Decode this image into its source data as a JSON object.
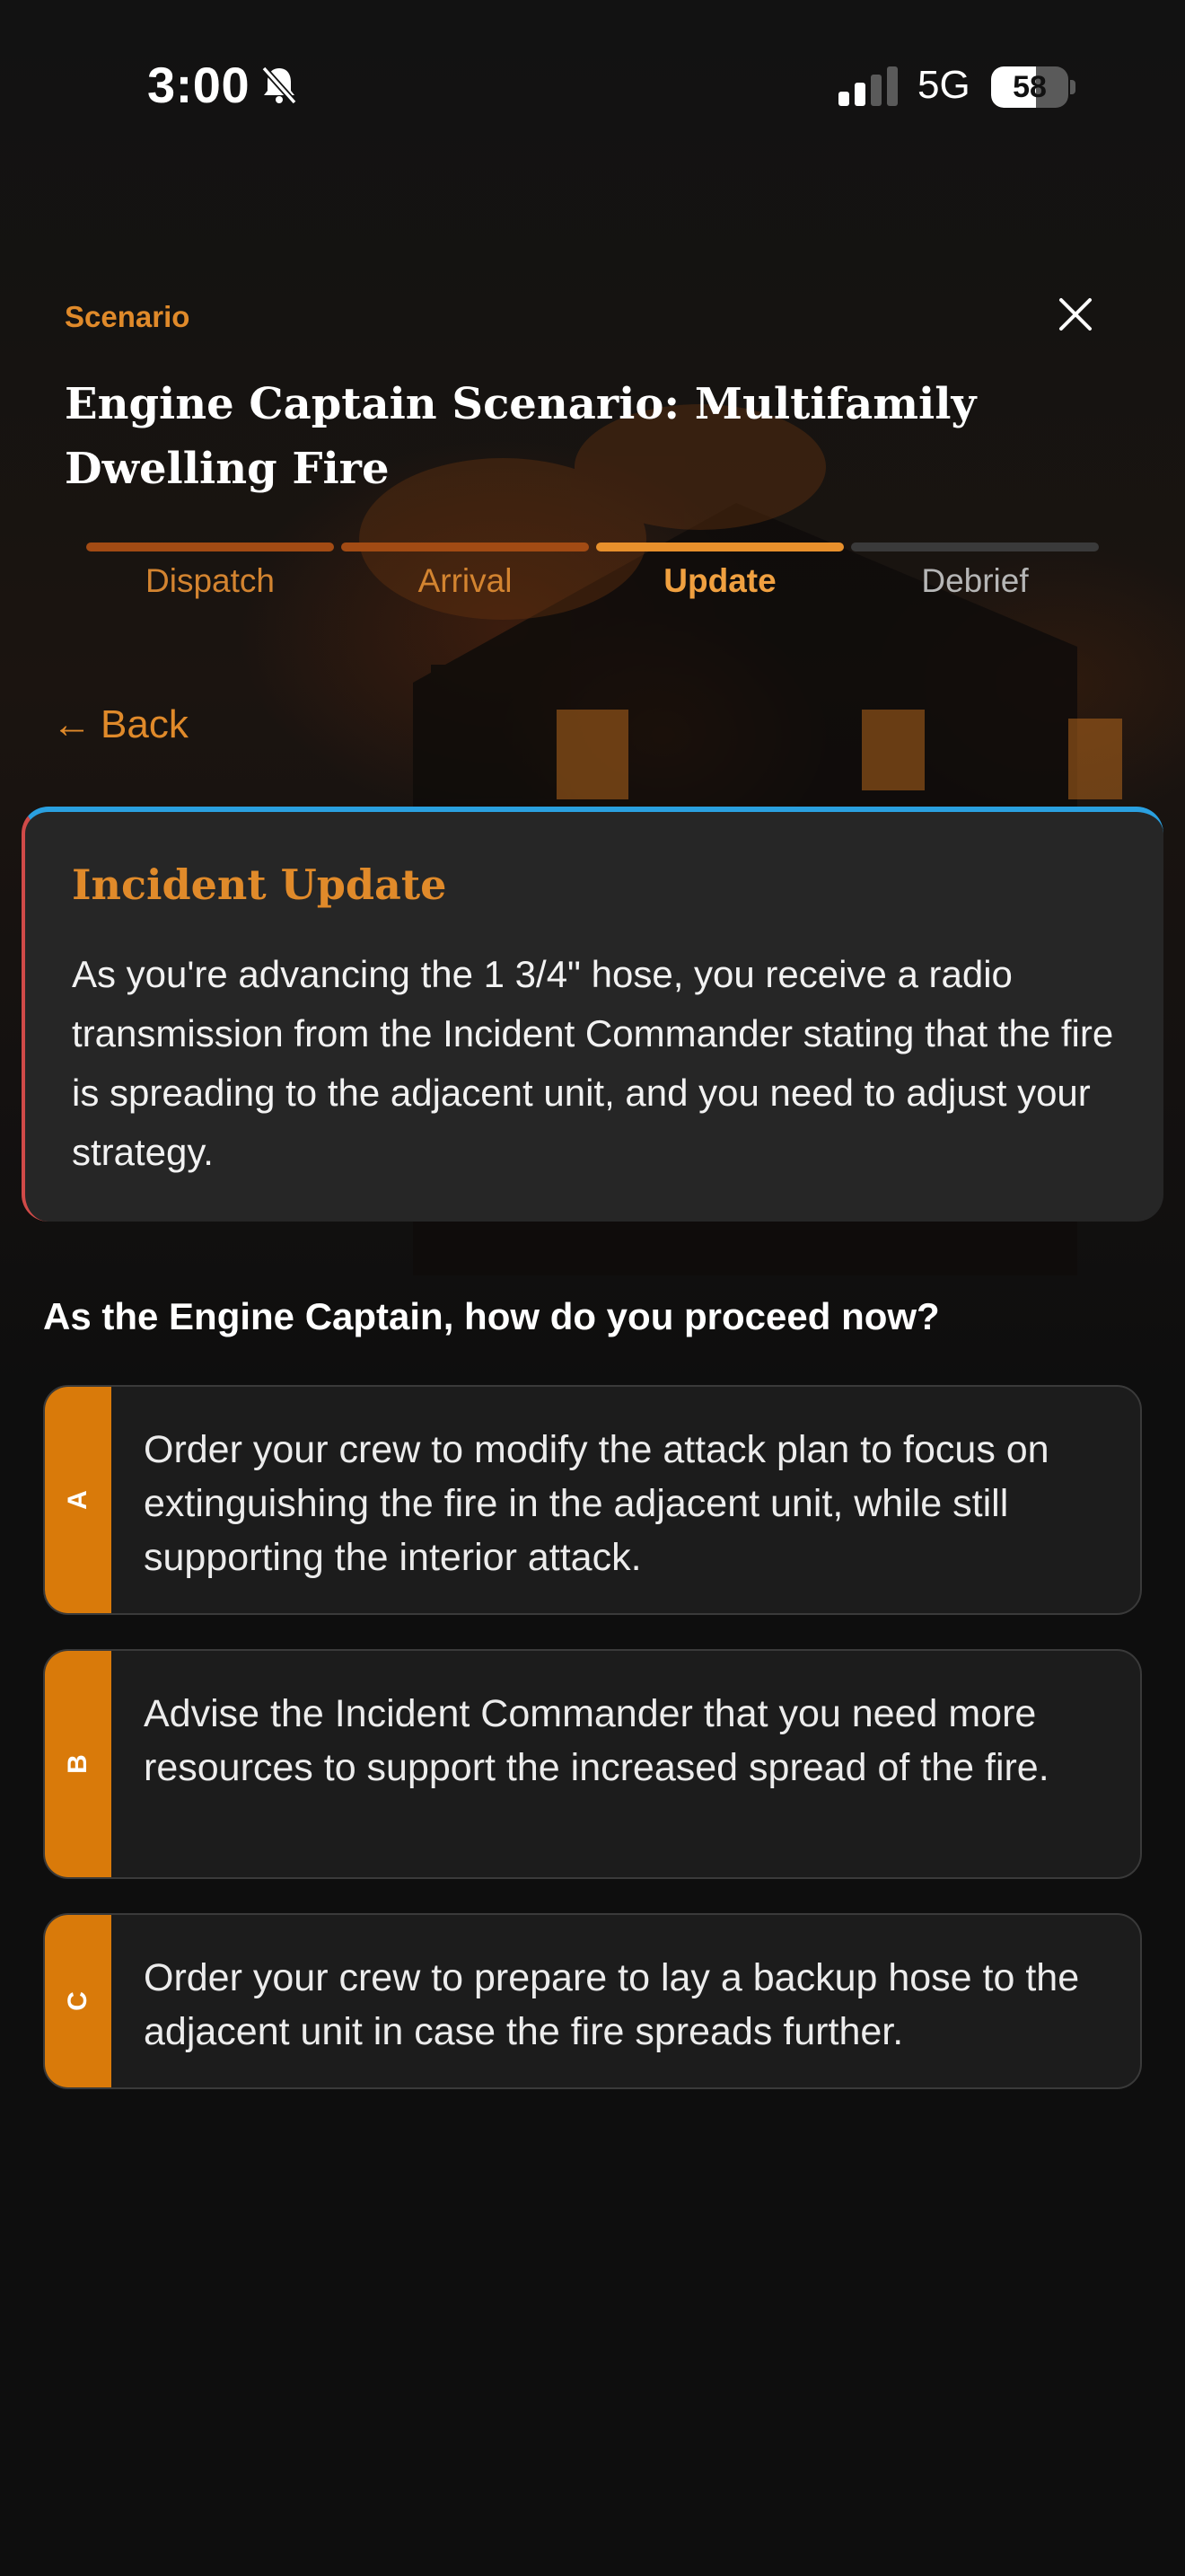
{
  "status_bar": {
    "time": "3:00",
    "network": "5G",
    "battery": "58",
    "battery_level": 0.58
  },
  "header": {
    "eyebrow": "Scenario",
    "title": "Engine Captain Scenario: Multifamily Dwelling Fire"
  },
  "steps": [
    {
      "label": "Dispatch",
      "state": "done"
    },
    {
      "label": "Arrival",
      "state": "done"
    },
    {
      "label": "Update",
      "state": "active"
    },
    {
      "label": "Debrief",
      "state": "future"
    }
  ],
  "back": {
    "arrow": "←",
    "label": "Back"
  },
  "update": {
    "heading": "Incident Update",
    "body": "As you're advancing the 1 3/4\" hose, you receive a radio transmission from the Incident Commander stating that the fire is spreading to the adjacent unit, and you need to adjust your strategy."
  },
  "question": "As the Engine Captain, how do you proceed now?",
  "options": [
    {
      "letter": "A",
      "text": "Order your crew to modify the attack plan to focus on extinguishing the fire in the adjacent unit, while still supporting the interior attack."
    },
    {
      "letter": "B",
      "text": "Advise the Incident Commander that you need more resources to support the increased spread of the fire."
    },
    {
      "letter": "C",
      "text": "Order your crew to prepare to lay a backup hose to the adjacent unit in case the fire spreads further."
    }
  ],
  "colors": {
    "accent": "#e08a2a",
    "option_tag": "#d97a0a",
    "card_top": "#2aa0e0",
    "card_left": "#d04a48"
  },
  "icons": {
    "mute": "bell-slash-icon",
    "close": "close-icon",
    "signal": "signal-icon",
    "battery": "battery-icon"
  }
}
